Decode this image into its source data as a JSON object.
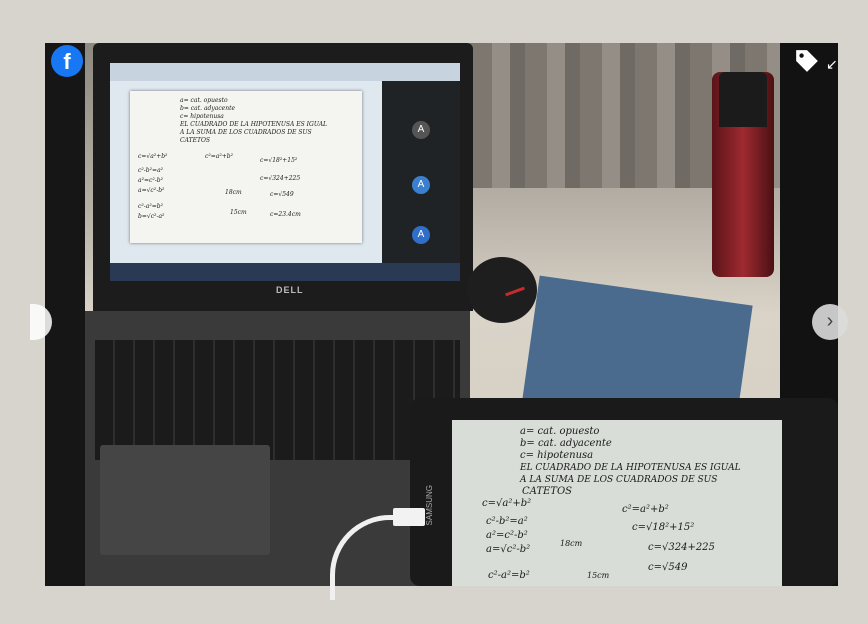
{
  "overlay": {
    "facebook_icon_glyph": "f",
    "collapse_glyph": "↙",
    "next_glyph": "›"
  },
  "photo": {
    "laptop_brand": "DELL",
    "tablet_brand": "SAMSUNG",
    "meet_avatar_letter": "A",
    "notes_lines": [
      "a= cat. opuesto",
      "b= cat. adyacente",
      "c= hipotenusa",
      "EL CUADRADO DE LA HIPOTENUSA ES IGUAL",
      "A LA SUMA DE LOS CUADRADOS DE SUS",
      "CATETOS"
    ],
    "notes_formulas": [
      "c=√a²+b²",
      "c²=a²+b²",
      "c²-b²=a²",
      "a²=c²-b²",
      "a=√c²-b²",
      "c²-a²=b²",
      "b=√c²-a²"
    ],
    "notes_calc": [
      "c=√18²+15²",
      "c=√324+225",
      "c=√549",
      "c=23.4cm"
    ],
    "notes_triangle_labels": [
      "18cm",
      "15cm"
    ]
  },
  "colors": {
    "facebook_blue": "#1877f2",
    "bottle_red": "#9e2a30",
    "notebook_blue": "#4b6b8e"
  }
}
